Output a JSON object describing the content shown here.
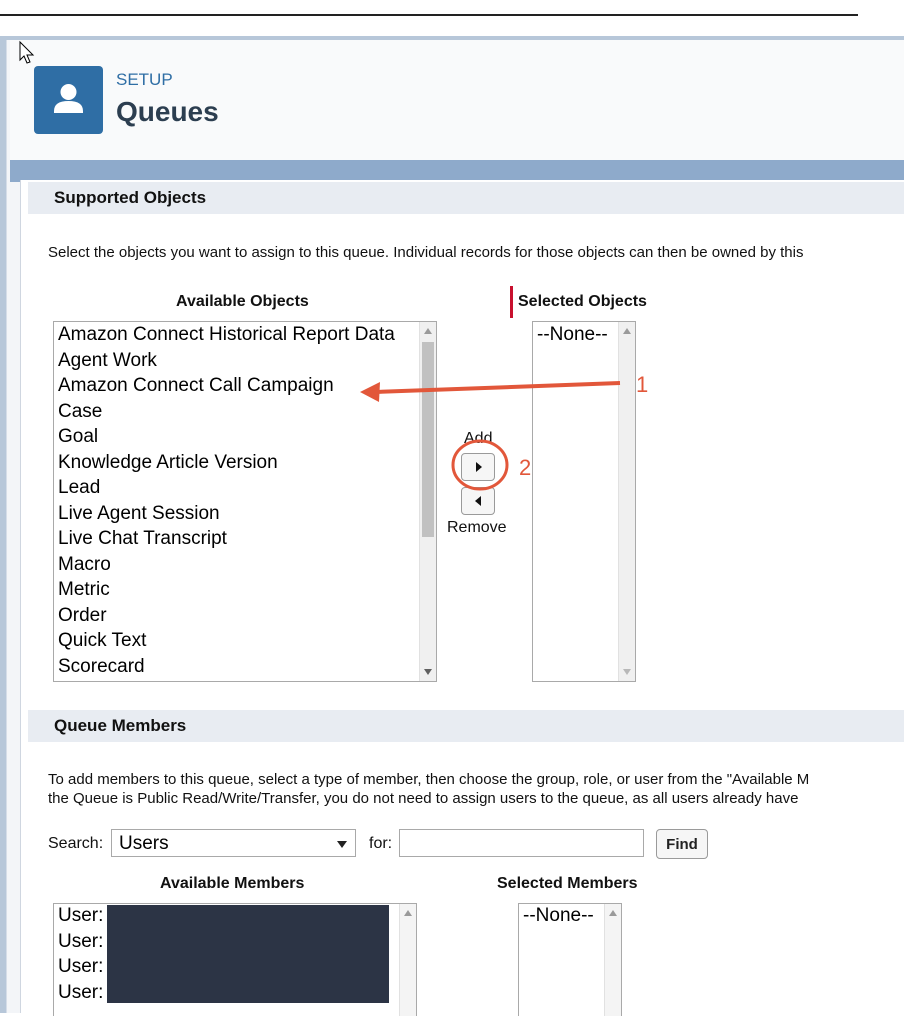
{
  "header": {
    "setup_label": "SETUP",
    "title": "Queues",
    "icon": "user-icon",
    "accent_color": "#2f6ea5"
  },
  "supported_objects": {
    "title": "Supported Objects",
    "description": "Select the objects you want to assign to this queue. Individual records for those objects can then be owned by this",
    "available_label": "Available Objects",
    "selected_label": "Selected Objects",
    "available_items": [
      "Amazon Connect Historical Report Data",
      "Agent Work",
      "Amazon Connect Call Campaign",
      "Case",
      "Goal",
      "Knowledge Article Version",
      "Lead",
      "Live Agent Session",
      "Live Chat Transcript",
      "Macro",
      "Metric",
      "Order",
      "Quick Text",
      "Scorecard"
    ],
    "selected_items": [
      "--None--"
    ],
    "add_label": "Add",
    "remove_label": "Remove"
  },
  "queue_members": {
    "title": "Queue Members",
    "description_line1": "To add members to this queue, select a type of member, then choose the group, role, or user from the \"Available M",
    "description_line2": "the Queue is Public Read/Write/Transfer, you do not need to assign users to the queue, as all users already have",
    "search_label": "Search:",
    "search_type": "Users",
    "for_label": "for:",
    "for_value": "",
    "find_label": "Find",
    "available_label": "Available Members",
    "selected_label": "Selected Members",
    "available_items": [
      "User:",
      "User:",
      "User:",
      "User:"
    ],
    "selected_items": [
      "--None--"
    ]
  },
  "annotations": {
    "step1": "1",
    "step2": "2",
    "color": "#e2573a"
  }
}
